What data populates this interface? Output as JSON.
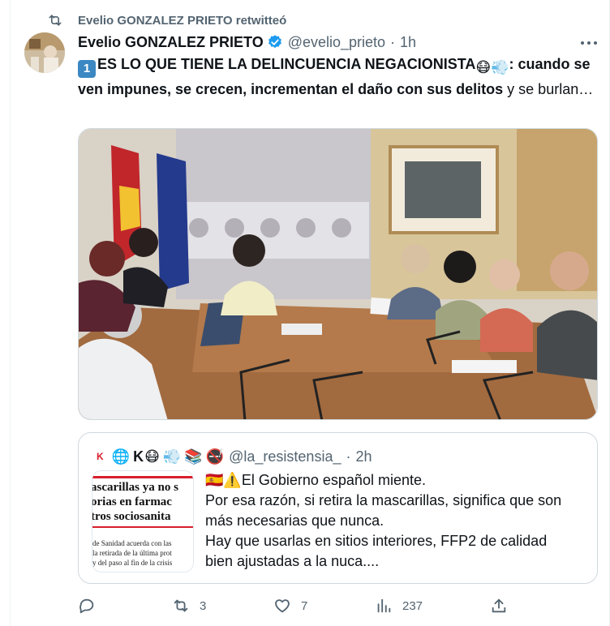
{
  "retweet": {
    "label": "Evelio GONZALEZ PRIETO retwitteó",
    "icon": "retweet-icon"
  },
  "tweet": {
    "author_name": "Evelio GONZALEZ PRIETO",
    "handle": "@evelio_prieto",
    "separator": "·",
    "time": "1h",
    "text": {
      "keycap": "1",
      "bold_part_1": "ES LO QUE TIENE LA DELINCUENCIA NEGACIONISTA",
      "emoji_mask": "😷",
      "emoji_wind": "💨",
      "bold_part_2": ": cuando se ven impunes, se crecen, incrementan el daño con sus delitos",
      "normal_part": " y se burlan…"
    }
  },
  "quoted": {
    "name_prefix": "K",
    "name_k": "K",
    "name_emojis": [
      "🌐",
      "😷",
      "💨",
      "📚",
      "🚭"
    ],
    "handle": "@la_resistensia_",
    "separator": "·",
    "time": "2h",
    "lines": [
      "El Gobierno español miente.",
      "Por esa razón, si retira la mascarillas, significa que son",
      "más necesarias que nunca.",
      "Hay que usarlas en sitios interiores, FFP2 de calidad",
      "bien ajustadas a la nuca...."
    ],
    "line1_emojis": [
      "🇪🇸",
      "⚠️"
    ],
    "thumb_lines": [
      "ascarillas ya no s",
      "orias en farmac",
      "tros sociosanita"
    ],
    "thumb_small": [
      "de Sanidad acuerda con las",
      "la retirada de la última prot",
      "y del paso al fin de la crisis"
    ]
  },
  "actions": {
    "reply": {
      "icon": "reply-icon",
      "count": ""
    },
    "retweet": {
      "icon": "retweet-icon",
      "count": "3"
    },
    "like": {
      "icon": "heart-icon",
      "count": "7"
    },
    "views": {
      "icon": "views-icon",
      "count": "237"
    },
    "share": {
      "icon": "share-icon",
      "count": ""
    }
  },
  "colors": {
    "verified": "#1d9bf0",
    "secondary_text": "#536471",
    "border": "#cfd9de",
    "keycap": "#3b88c3"
  }
}
